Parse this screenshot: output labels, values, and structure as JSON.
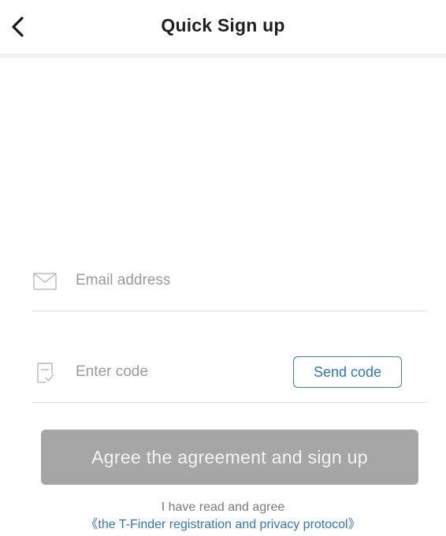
{
  "header": {
    "title": "Quick Sign up",
    "back_icon": "chevron-left-icon"
  },
  "form": {
    "email": {
      "icon": "envelope-icon",
      "placeholder": "Email address",
      "value": ""
    },
    "code": {
      "icon": "verification-code-icon",
      "placeholder": "Enter code",
      "value": "",
      "send_button_label": "Send code"
    },
    "submit_label": "Agree the agreement and sign up"
  },
  "agreement": {
    "prefix": "I have read and agree ",
    "link_text": "《the T-Finder registration and privacy protocol》"
  },
  "colors": {
    "link": "#2f77bd",
    "button_disabled": "#a6a6a6",
    "divider": "#f1f1f1"
  }
}
